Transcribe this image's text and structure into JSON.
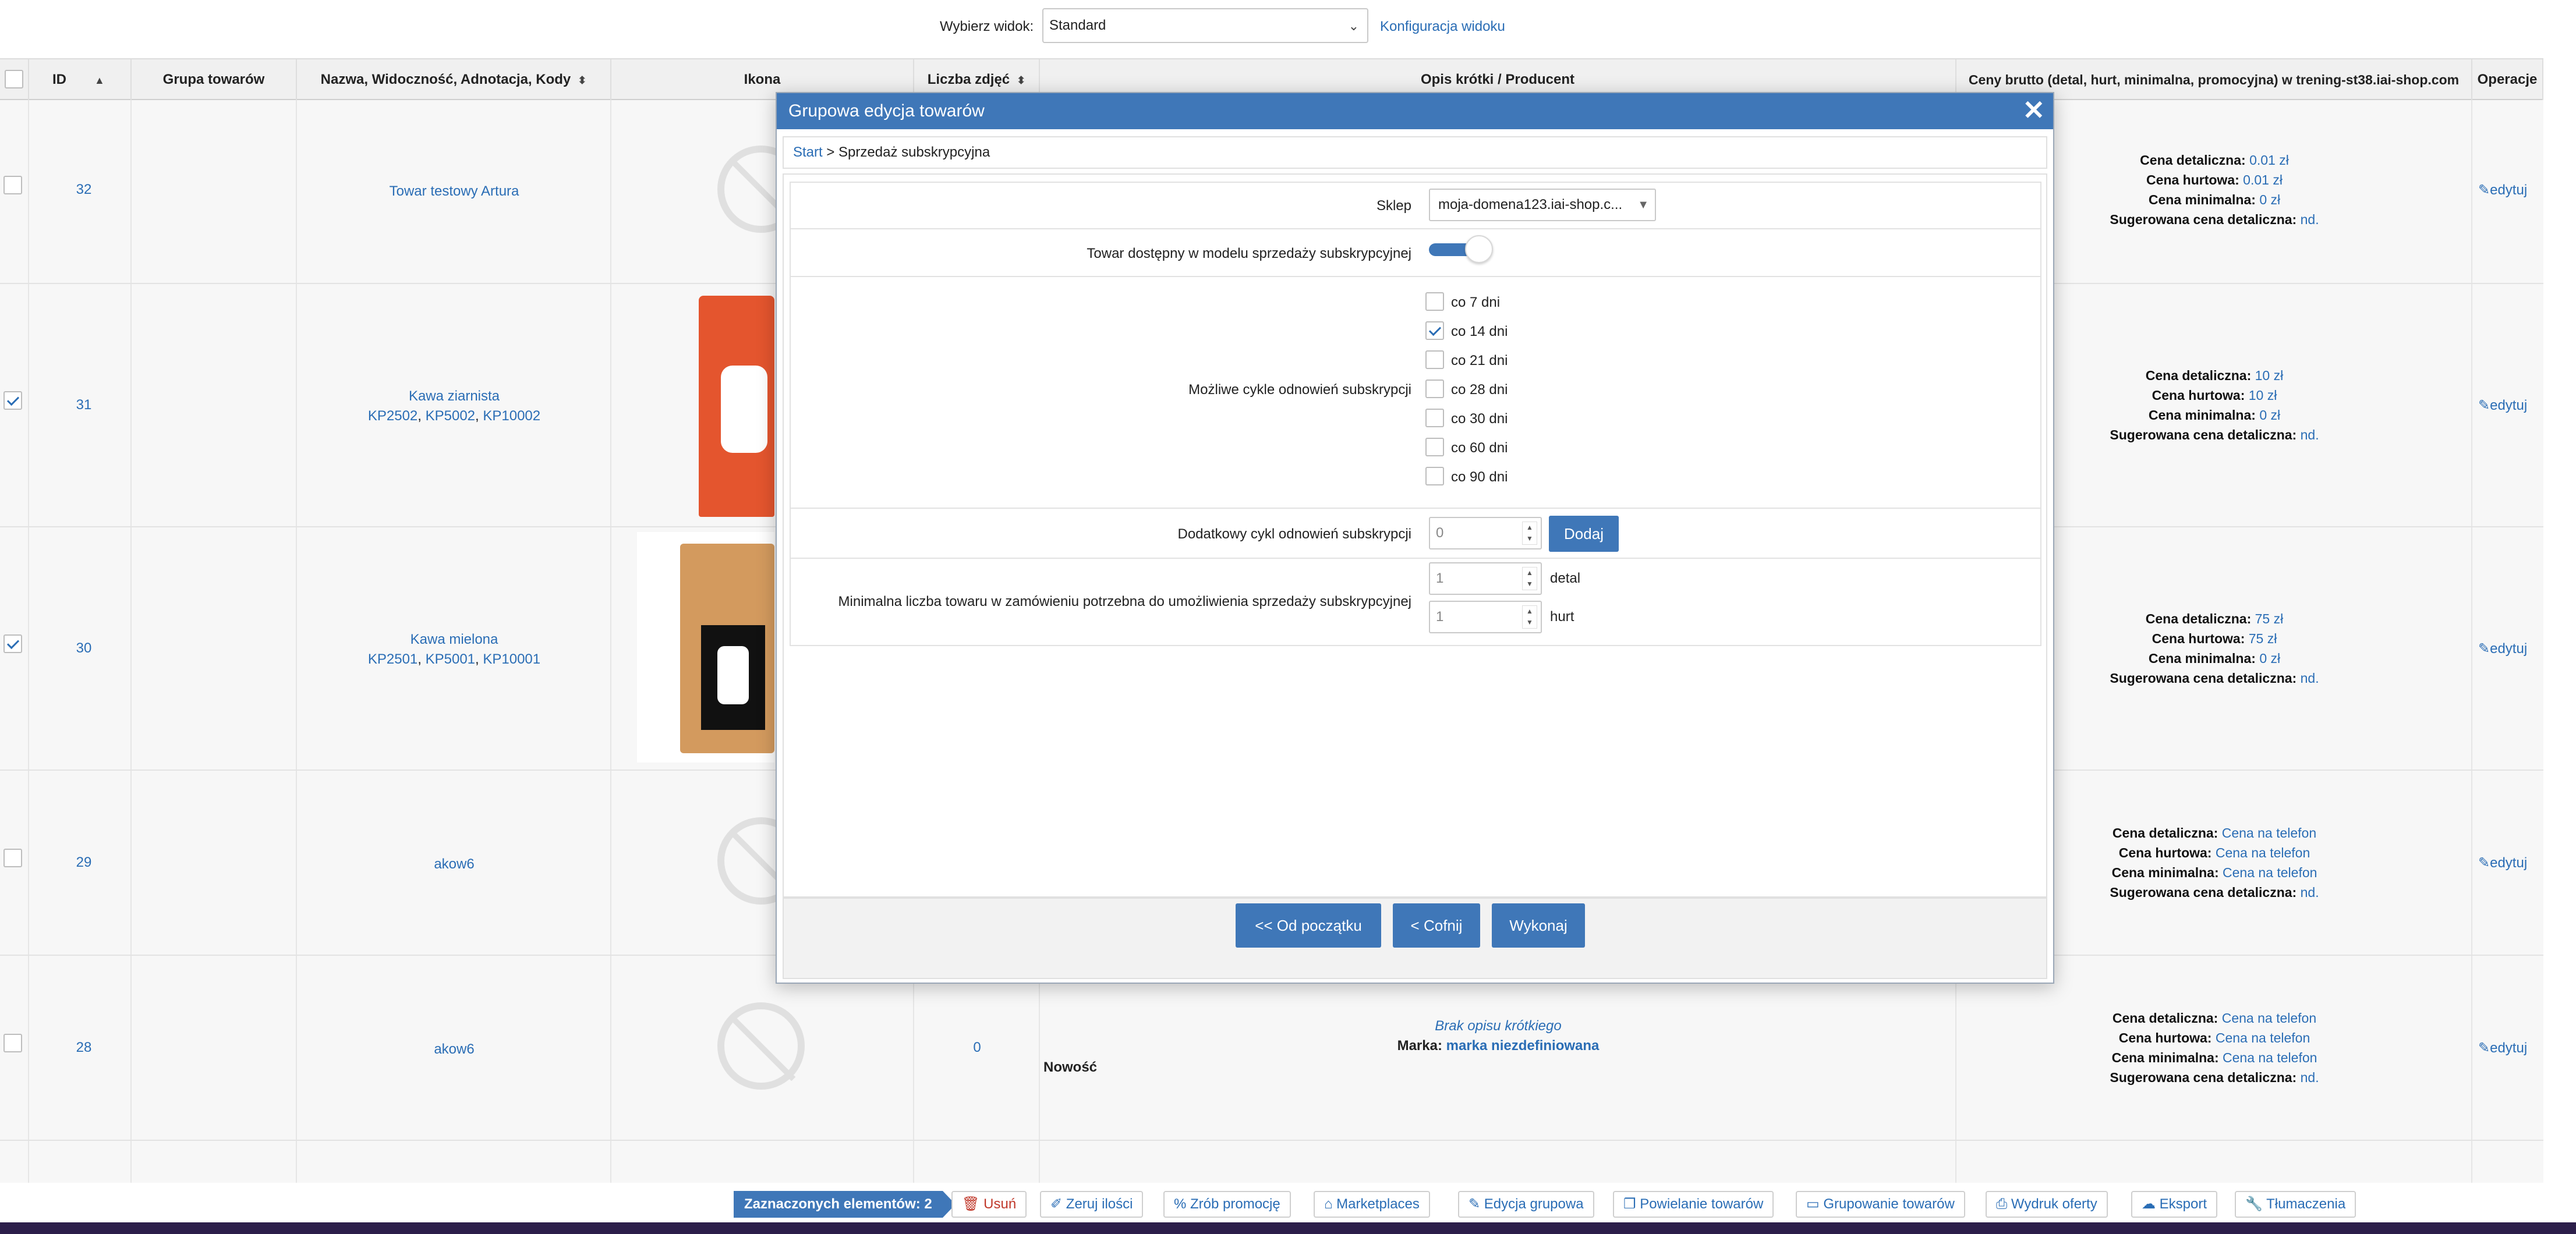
{
  "viewbar": {
    "label": "Wybierz widok:",
    "selected": "Standard",
    "config_link": "Konfiguracja widoku"
  },
  "table": {
    "columns": [
      "ID",
      "Grupa towarów",
      "Nazwa, Widoczność, Adnotacja, Kody",
      "Ikona",
      "Liczba zdjęć",
      "Opis krótki / Producent",
      "Ceny brutto (detal, hurt, minimalna, promocyjna) w trening-st38.iai-shop.com",
      "Operacje"
    ],
    "rows": [
      {
        "id": "32",
        "checked": false,
        "name": "Towar testowy Artura",
        "codes": [],
        "prices": {
          "detal_label": "Cena detaliczna:",
          "detal": "0.01 zł",
          "hurt_label": "Cena hurtowa:",
          "hurt": "0.01 zł",
          "min_label": "Cena minimalna:",
          "min": "0 zł",
          "sug_label": "Sugerowana cena detaliczna:",
          "sug": "nd."
        },
        "edit": "edytuj"
      },
      {
        "id": "31",
        "checked": true,
        "name": "Kawa ziarnista",
        "codes": [
          "KP2502",
          "KP5002",
          "KP10002"
        ],
        "prices": {
          "detal_label": "Cena detaliczna:",
          "detal": "10 zł",
          "hurt_label": "Cena hurtowa:",
          "hurt": "10 zł",
          "min_label": "Cena minimalna:",
          "min": "0 zł",
          "sug_label": "Sugerowana cena detaliczna:",
          "sug": "nd."
        },
        "edit": "edytuj"
      },
      {
        "id": "30",
        "checked": true,
        "name": "Kawa mielona",
        "codes": [
          "KP2501",
          "KP5001",
          "KP10001"
        ],
        "prices": {
          "detal_label": "Cena detaliczna:",
          "detal": "75 zł",
          "hurt_label": "Cena hurtowa:",
          "hurt": "75 zł",
          "min_label": "Cena minimalna:",
          "min": "0 zł",
          "sug_label": "Sugerowana cena detaliczna:",
          "sug": "nd."
        },
        "edit": "edytuj"
      },
      {
        "id": "29",
        "checked": false,
        "name": "akow6",
        "codes": [],
        "prices": {
          "detal_label": "Cena detaliczna:",
          "detal": "Cena na telefon",
          "hurt_label": "Cena hurtowa:",
          "hurt": "Cena na telefon",
          "min_label": "Cena minimalna:",
          "min": "Cena na telefon",
          "sug_label": "Sugerowana cena detaliczna:",
          "sug": "nd."
        },
        "edit": "edytuj"
      },
      {
        "id": "28",
        "checked": false,
        "name": "akow6",
        "codes": [],
        "photos": "0",
        "desc": "Brak opisu krótkiego",
        "brand_label": "Marka:",
        "brand": "marka niezdefiniowana",
        "tag": "Nowość",
        "prices": {
          "detal_label": "Cena detaliczna:",
          "detal": "Cena na telefon",
          "hurt_label": "Cena hurtowa:",
          "hurt": "Cena na telefon",
          "min_label": "Cena minimalna:",
          "min": "Cena na telefon",
          "sug_label": "Sugerowana cena detaliczna:",
          "sug": "nd."
        },
        "edit": "edytuj"
      }
    ]
  },
  "bottombar": {
    "selected": "Zaznaczonych elementów: 2",
    "buttons": [
      "Usuń",
      "Zeruj ilości",
      "Zrób promocję",
      "Marketplaces",
      "Edycja grupowa",
      "Powielanie towarów",
      "Grupowanie towarów",
      "Wydruk oferty",
      "Eksport",
      "Tłumaczenia"
    ]
  },
  "modal": {
    "title": "Grupowa edycja towarów",
    "close": "✕",
    "breadcrumb_start": "Start",
    "breadcrumb_sep": " > ",
    "breadcrumb_current": "Sprzedaż subskrypcyjna",
    "shop_label": "Sklep",
    "shop_value": "moja-domena123.iai-shop.c...",
    "available_label": "Towar dostępny w modelu sprzedaży subskrypcyjnej",
    "cycles_label": "Możliwe cykle odnowień subskrypcji",
    "cycles": [
      {
        "label": "co 7 dni",
        "checked": false
      },
      {
        "label": "co 14 dni",
        "checked": true
      },
      {
        "label": "co 21 dni",
        "checked": false
      },
      {
        "label": "co 28 dni",
        "checked": false
      },
      {
        "label": "co 30 dni",
        "checked": false
      },
      {
        "label": "co 60 dni",
        "checked": false
      },
      {
        "label": "co 90 dni",
        "checked": false
      }
    ],
    "extra_cycle_label": "Dodatkowy cykl odnowień subskrypcji",
    "extra_cycle_value": "0",
    "add_button": "Dodaj",
    "min_qty_label": "Minimalna liczba towaru w zamówieniu potrzebna do umożliwienia sprzedaży subskrypcyjnej",
    "min_qty_detal": "1",
    "min_qty_detal_label": "detal",
    "min_qty_hurt": "1",
    "min_qty_hurt_label": "hurt",
    "btn_start": "<< Od początku",
    "btn_back": "< Cofnij",
    "btn_exec": "Wykonaj"
  }
}
